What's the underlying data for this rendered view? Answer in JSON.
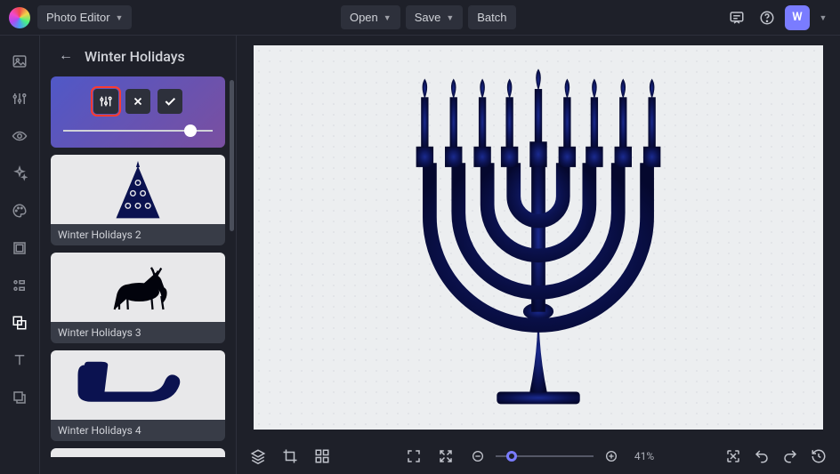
{
  "app": {
    "name": "Photo Editor",
    "user_initial": "W"
  },
  "header_actions": {
    "open": "Open",
    "save": "Save",
    "batch": "Batch"
  },
  "sidebar": {
    "title": "Winter Holidays",
    "slider_value": 85,
    "presets": [
      {
        "label": "Winter Holidays 2",
        "art": "tree"
      },
      {
        "label": "Winter Holidays 3",
        "art": "deer"
      },
      {
        "label": "Winter Holidays 4",
        "art": "sleigh"
      }
    ]
  },
  "zoom": {
    "percent_label": "41%",
    "percent": 41
  },
  "colors": {
    "accent": "#7a7cff",
    "highlight": "#ff3b2f",
    "ink": "#0b1250"
  }
}
